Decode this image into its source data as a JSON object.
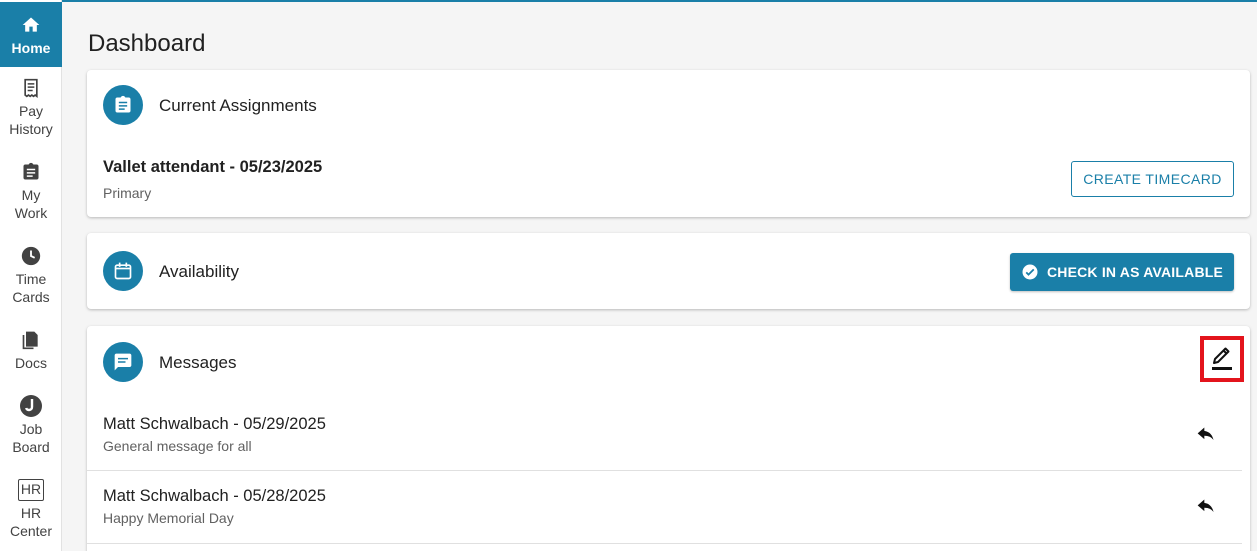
{
  "sidebar": {
    "items": [
      {
        "label": "Home",
        "icon": "home-icon"
      },
      {
        "label": "Pay\nHistory",
        "icon": "receipt-icon"
      },
      {
        "label": "My\nWork",
        "icon": "clipboard-icon"
      },
      {
        "label": "Time\nCards",
        "icon": "clock-icon"
      },
      {
        "label": "Docs",
        "icon": "documents-icon"
      },
      {
        "label": "Job\nBoard",
        "icon": "job-board-icon"
      },
      {
        "label": "HR\nCenter",
        "icon": "hr-icon"
      }
    ],
    "hr_badge": "HR"
  },
  "page": {
    "title": "Dashboard"
  },
  "assignments": {
    "title": "Current Assignments",
    "item_title": "Vallet attendant - 05/23/2025",
    "item_sub": "Primary",
    "button": "CREATE TIMECARD"
  },
  "availability": {
    "title": "Availability",
    "button": "CHECK IN AS AVAILABLE"
  },
  "messages": {
    "title": "Messages",
    "items": [
      {
        "title": "Matt Schwalbach - 05/29/2025",
        "body": "General message for all"
      },
      {
        "title": "Matt Schwalbach - 05/28/2025",
        "body": "Happy Memorial Day"
      }
    ]
  },
  "colors": {
    "accent": "#1a7fa8",
    "highlight": "#e3141c"
  }
}
